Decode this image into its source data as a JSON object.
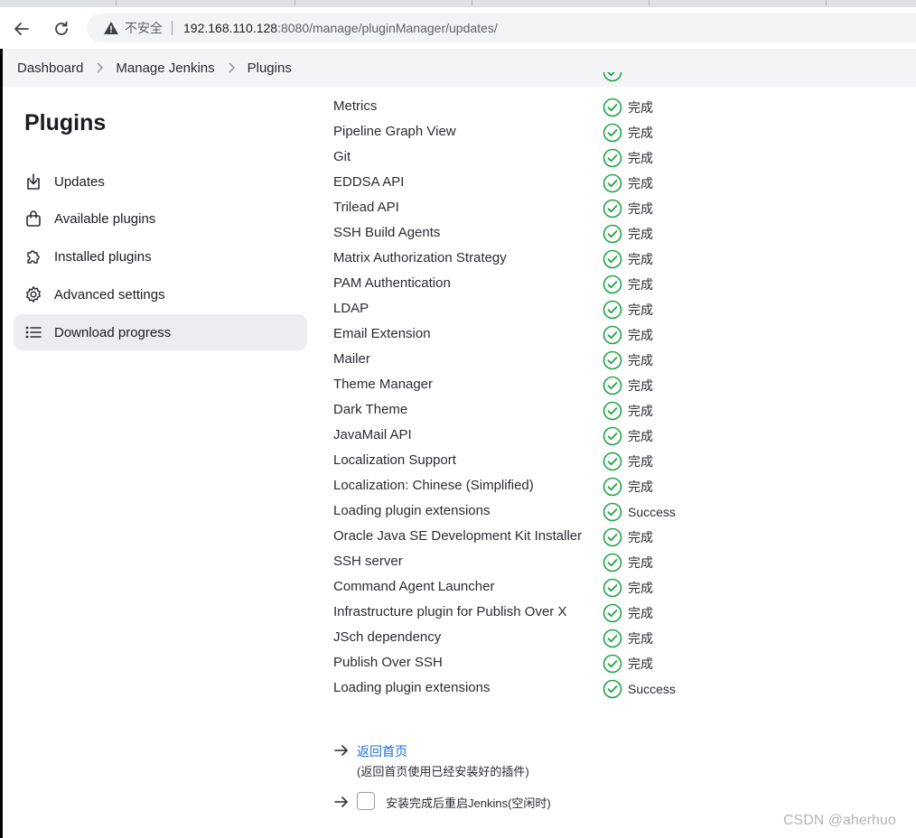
{
  "browser": {
    "address_warning": "不安全",
    "url_host": "192.168.110.128",
    "url_rest": ":8080/manage/pluginManager/updates/"
  },
  "breadcrumb": [
    "Dashboard",
    "Manage Jenkins",
    "Plugins"
  ],
  "sidebar": {
    "title": "Plugins",
    "items": [
      {
        "label": "Updates",
        "icon": "download-icon"
      },
      {
        "label": "Available plugins",
        "icon": "shopping-bag-icon"
      },
      {
        "label": "Installed plugins",
        "icon": "puzzle-icon"
      },
      {
        "label": "Advanced settings",
        "icon": "gear-icon"
      },
      {
        "label": "Download progress",
        "icon": "list-icon",
        "active": true
      }
    ]
  },
  "plugins": [
    {
      "name": "Metrics",
      "status": "完成"
    },
    {
      "name": "Pipeline Graph View",
      "status": "完成"
    },
    {
      "name": "Git",
      "status": "完成"
    },
    {
      "name": "EDDSA API",
      "status": "完成"
    },
    {
      "name": "Trilead API",
      "status": "完成"
    },
    {
      "name": "SSH Build Agents",
      "status": "完成"
    },
    {
      "name": "Matrix Authorization Strategy",
      "status": "完成"
    },
    {
      "name": "PAM Authentication",
      "status": "完成"
    },
    {
      "name": "LDAP",
      "status": "完成"
    },
    {
      "name": "Email Extension",
      "status": "完成"
    },
    {
      "name": "Mailer",
      "status": "完成"
    },
    {
      "name": "Theme Manager",
      "status": "完成"
    },
    {
      "name": "Dark Theme",
      "status": "完成"
    },
    {
      "name": "JavaMail API",
      "status": "完成"
    },
    {
      "name": "Localization Support",
      "status": "完成"
    },
    {
      "name": "Localization: Chinese (Simplified)",
      "status": "完成"
    },
    {
      "name": "Loading plugin extensions",
      "status": "Success"
    },
    {
      "name": "Oracle Java SE Development Kit Installer",
      "status": "完成"
    },
    {
      "name": "SSH server",
      "status": "完成"
    },
    {
      "name": "Command Agent Launcher",
      "status": "完成"
    },
    {
      "name": "Infrastructure plugin for Publish Over X",
      "status": "完成"
    },
    {
      "name": "JSch dependency",
      "status": "完成"
    },
    {
      "name": "Publish Over SSH",
      "status": "完成"
    },
    {
      "name": "Loading plugin extensions",
      "status": "Success"
    }
  ],
  "actions": {
    "home_link": "返回首页",
    "home_desc": "(返回首页使用已经安装好的插件)",
    "restart_label": "安装完成后重启Jenkins(空闲时)"
  },
  "watermark": "CSDN @aherhuo",
  "colors": {
    "success_green": "#1ea446",
    "link_blue": "#1f6fd6",
    "crumb_bg": "#f4f4f7",
    "active_bg": "#ececf1"
  }
}
